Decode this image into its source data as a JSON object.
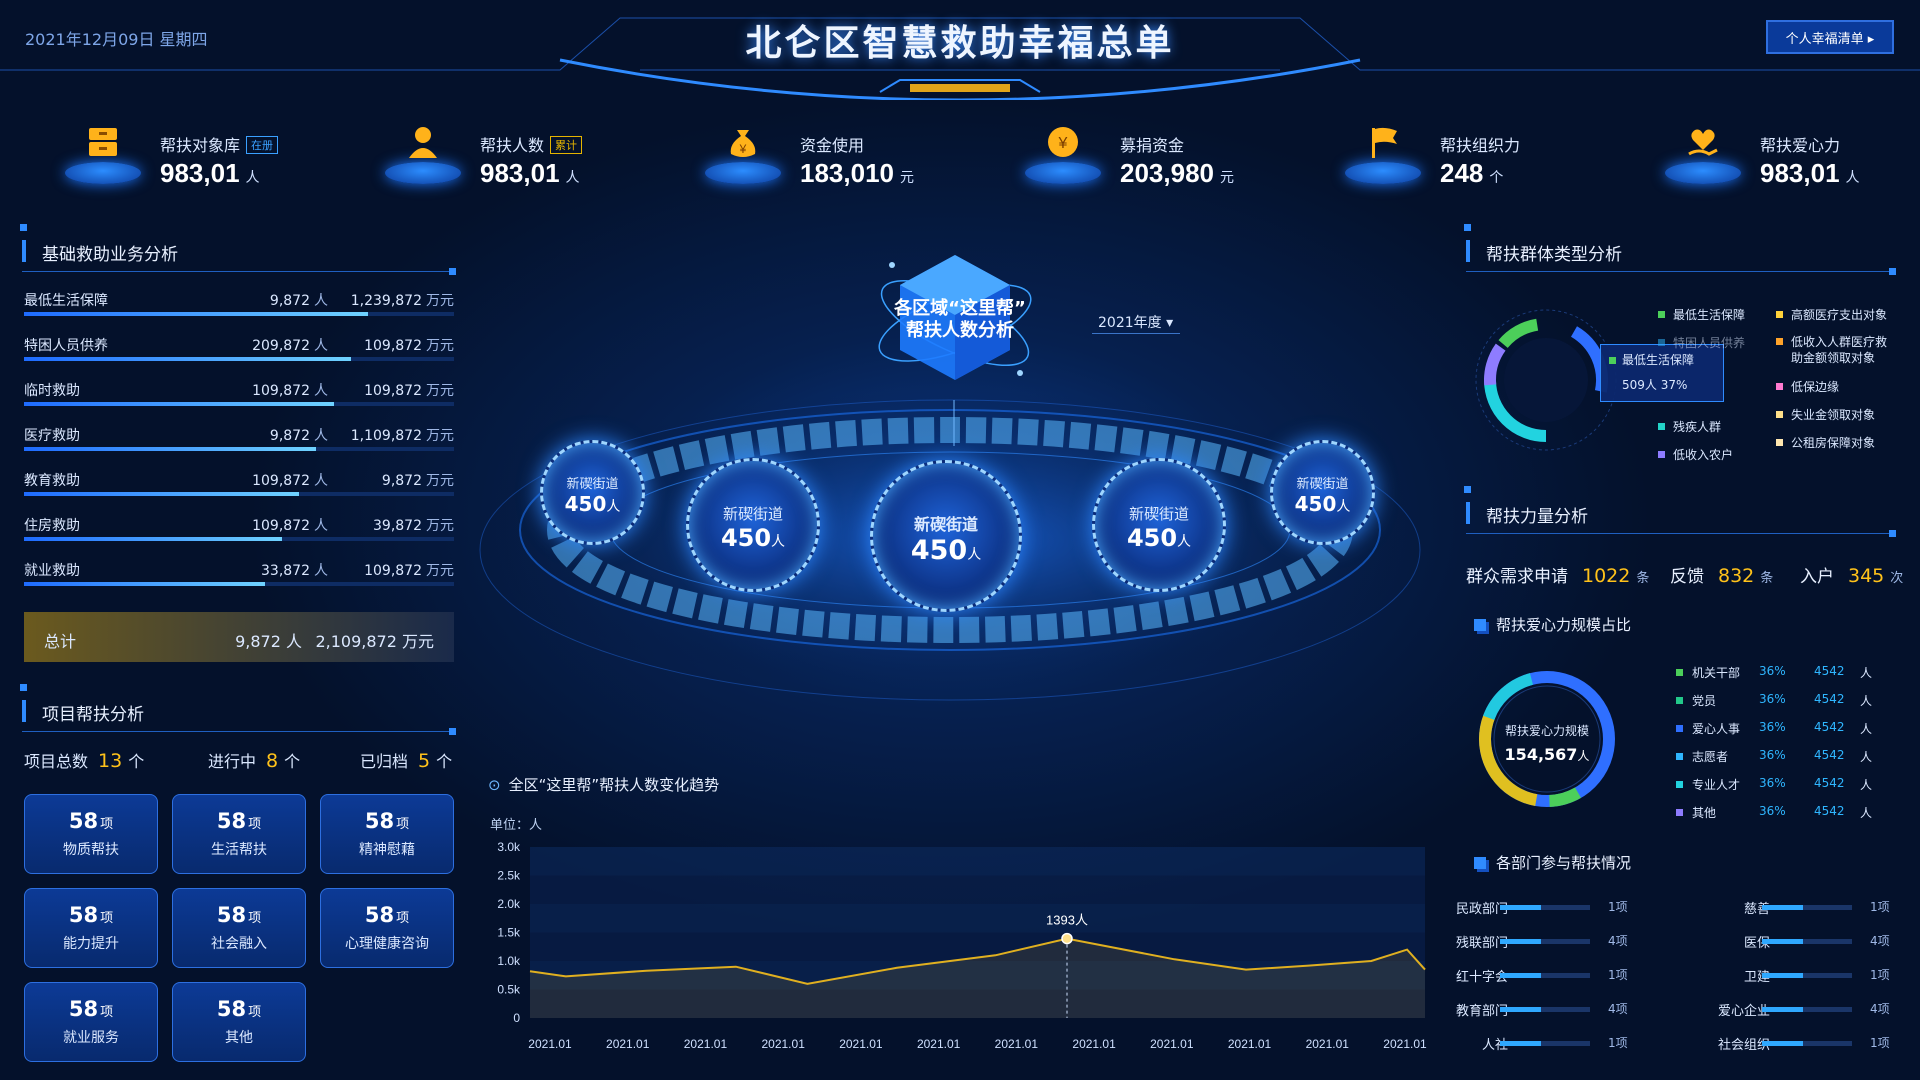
{
  "header": {
    "date": "2021年12月09日  星期四",
    "title": "北仑区智慧救助幸福总单",
    "button_label": "个人幸福清单 ▸"
  },
  "kpis": [
    {
      "label": "帮扶对象库",
      "tag": "在册",
      "value": "983,01",
      "unit": "人",
      "icon": "drawer-icon"
    },
    {
      "label": "帮扶人数",
      "tag": "累计",
      "value": "983,01",
      "unit": "人",
      "icon": "person-icon"
    },
    {
      "label": "资金使用",
      "tag": "",
      "value": "183,010",
      "unit": "元",
      "icon": "money-bag-icon"
    },
    {
      "label": "募捐资金",
      "tag": "",
      "value": "203,980",
      "unit": "元",
      "icon": "yen-coin-icon"
    },
    {
      "label": "帮扶组织力",
      "tag": "",
      "value": "248",
      "unit": "个",
      "icon": "flag-icon"
    },
    {
      "label": "帮扶爱心力",
      "tag": "",
      "value": "983,01",
      "unit": "人",
      "icon": "heart-hand-icon"
    }
  ],
  "basic": {
    "title": "基础救助业务分析",
    "person_unit": "人",
    "money_unit": "万元",
    "rows": [
      {
        "name": "最低生活保障",
        "people": "9,872",
        "money": "1,239,872",
        "progress": 0.8
      },
      {
        "name": "特困人员供养",
        "people": "209,872",
        "money": "109,872",
        "progress": 0.76
      },
      {
        "name": "临时救助",
        "people": "109,872",
        "money": "109,872",
        "progress": 0.72
      },
      {
        "name": "医疗救助",
        "people": "9,872",
        "money": "1,109,872",
        "progress": 0.68
      },
      {
        "name": "教育救助",
        "people": "109,872",
        "money": "9,872",
        "progress": 0.64
      },
      {
        "name": "住房救助",
        "people": "109,872",
        "money": "39,872",
        "progress": 0.6
      },
      {
        "name": "就业救助",
        "people": "33,872",
        "money": "109,872",
        "progress": 0.56
      }
    ],
    "total": {
      "name": "总计",
      "people": "9,872",
      "money": "2,109,872"
    }
  },
  "project": {
    "title": "项目帮扶分析",
    "stats": [
      {
        "label": "项目总数",
        "value": "13",
        "unit": "个"
      },
      {
        "label": "进行中",
        "value": "8",
        "unit": "个"
      },
      {
        "label": "已归档",
        "value": "5",
        "unit": "个"
      }
    ],
    "unit": "项",
    "cards": [
      {
        "value": "58",
        "label": "物质帮扶"
      },
      {
        "value": "58",
        "label": "生活帮扶"
      },
      {
        "value": "58",
        "label": "精神慰藉"
      },
      {
        "value": "58",
        "label": "能力提升"
      },
      {
        "value": "58",
        "label": "社会融入"
      },
      {
        "value": "58",
        "label": "心理健康咨询"
      },
      {
        "value": "58",
        "label": "就业服务"
      },
      {
        "value": "58",
        "label": "其他"
      }
    ]
  },
  "center": {
    "cube_label_1": "各区域“这里帮”",
    "cube_label_2": "帮扶人数分析",
    "year": "2021年度 ▾",
    "orbs": [
      {
        "name": "新碶街道",
        "value": "450",
        "unit": "人"
      },
      {
        "name": "新碶街道",
        "value": "450",
        "unit": "人"
      },
      {
        "name": "新碶街道",
        "value": "450",
        "unit": "人"
      },
      {
        "name": "新碶街道",
        "value": "450",
        "unit": "人"
      },
      {
        "name": "新碶街道",
        "value": "450",
        "unit": "人"
      }
    ]
  },
  "trend": {
    "title": "全区“这里帮”帮扶人数变化趋势",
    "unit_label": "单位：人",
    "peak_label": "1393人"
  },
  "chart_data": {
    "type": "area",
    "title": "全区“这里帮”帮扶人数变化趋势",
    "ylabel": "单位：人",
    "y_ticks": [
      "3.0k",
      "2.5k",
      "2.0k",
      "1.5k",
      "1.0k",
      "0.5k",
      "0"
    ],
    "ylim": [
      0,
      3000
    ],
    "categories": [
      "2021.01",
      "2021.01",
      "2021.01",
      "2021.01",
      "2021.01",
      "2021.01",
      "2021.01",
      "2021.01",
      "2021.01",
      "2021.01",
      "2021.01",
      "2021.01"
    ],
    "values": [
      820,
      730,
      830,
      900,
      600,
      880,
      1100,
      1393,
      1030,
      850,
      920,
      1000,
      1200,
      850
    ],
    "x_fraction": [
      0.0,
      0.04,
      0.13,
      0.23,
      0.31,
      0.41,
      0.52,
      0.6,
      0.72,
      0.8,
      0.87,
      0.94,
      0.98,
      1.0
    ],
    "peak": {
      "value": 1393,
      "label": "1393人"
    },
    "color": "#e0b020"
  },
  "groups": {
    "title": "帮扶群体类型分析",
    "legend_left": [
      {
        "label": "最低生活保障",
        "color": "#4ccf5a"
      },
      {
        "label": "特困人员供养",
        "color": "#2fb6ff"
      },
      {
        "label": "最低生活保障",
        "color": "#4ccf5a"
      },
      {
        "label": "残疾人群",
        "color": "#22d3c8"
      },
      {
        "label": "低收入农户",
        "color": "#8e7cff"
      }
    ],
    "legend_right": [
      {
        "label": "高额医疗支出对象",
        "color": "#ffd23a"
      },
      {
        "label": "低收入人群医疗救助金额领取对象",
        "color": "#ffa32a"
      },
      {
        "label": "低保边缘",
        "color": "#ff7ad0"
      },
      {
        "label": "失业金领取对象",
        "color": "#ffe08a"
      },
      {
        "label": "公租房保障对象",
        "color": "#ffe7b0"
      }
    ],
    "tooltip": {
      "name": "最低生活保障",
      "value": "509人  37%"
    }
  },
  "force": {
    "title": "帮扶力量分析",
    "stats": [
      {
        "label": "群众需求申请",
        "value": "1022",
        "unit": "条"
      },
      {
        "label": "反馈",
        "value": "832",
        "unit": "条"
      },
      {
        "label": "入户",
        "value": "345",
        "unit": "次"
      }
    ]
  },
  "volunteer": {
    "title": "帮扶爱心力规模占比",
    "center_label": "帮扶爱心力规模",
    "center_value": "154,567",
    "center_unit": "人",
    "items": [
      {
        "name": "机关干部",
        "pct": "36%",
        "count": "4542",
        "unit": "人",
        "color": "#4ccf5a"
      },
      {
        "name": "党员",
        "pct": "36%",
        "count": "4542",
        "unit": "人",
        "color": "#22c98a"
      },
      {
        "name": "爱心人事",
        "pct": "36%",
        "count": "4542",
        "unit": "人",
        "color": "#2f6fff"
      },
      {
        "name": "志愿者",
        "pct": "36%",
        "count": "4542",
        "unit": "人",
        "color": "#2fb6ff"
      },
      {
        "name": "专业人才",
        "pct": "36%",
        "count": "4542",
        "unit": "人",
        "color": "#22d3e0"
      },
      {
        "name": "其他",
        "pct": "36%",
        "count": "4542",
        "unit": "人",
        "color": "#8e7cff"
      }
    ]
  },
  "depts": {
    "title": "各部门参与帮扶情况",
    "left": [
      {
        "name": "民政部门",
        "value": "1项",
        "progress": 0.45
      },
      {
        "name": "残联部门",
        "value": "4项",
        "progress": 0.45
      },
      {
        "name": "红十字会",
        "value": "1项",
        "progress": 0.45
      },
      {
        "name": "教育部门",
        "value": "4项",
        "progress": 0.45
      },
      {
        "name": "人社",
        "value": "1项",
        "progress": 0.45
      }
    ],
    "right": [
      {
        "name": "慈善",
        "value": "1项",
        "progress": 0.45
      },
      {
        "name": "医保",
        "value": "4项",
        "progress": 0.45
      },
      {
        "name": "卫建",
        "value": "1项",
        "progress": 0.45
      },
      {
        "name": "爱心企业",
        "value": "4项",
        "progress": 0.45
      },
      {
        "name": "社会组织",
        "value": "1项",
        "progress": 0.45
      }
    ]
  }
}
